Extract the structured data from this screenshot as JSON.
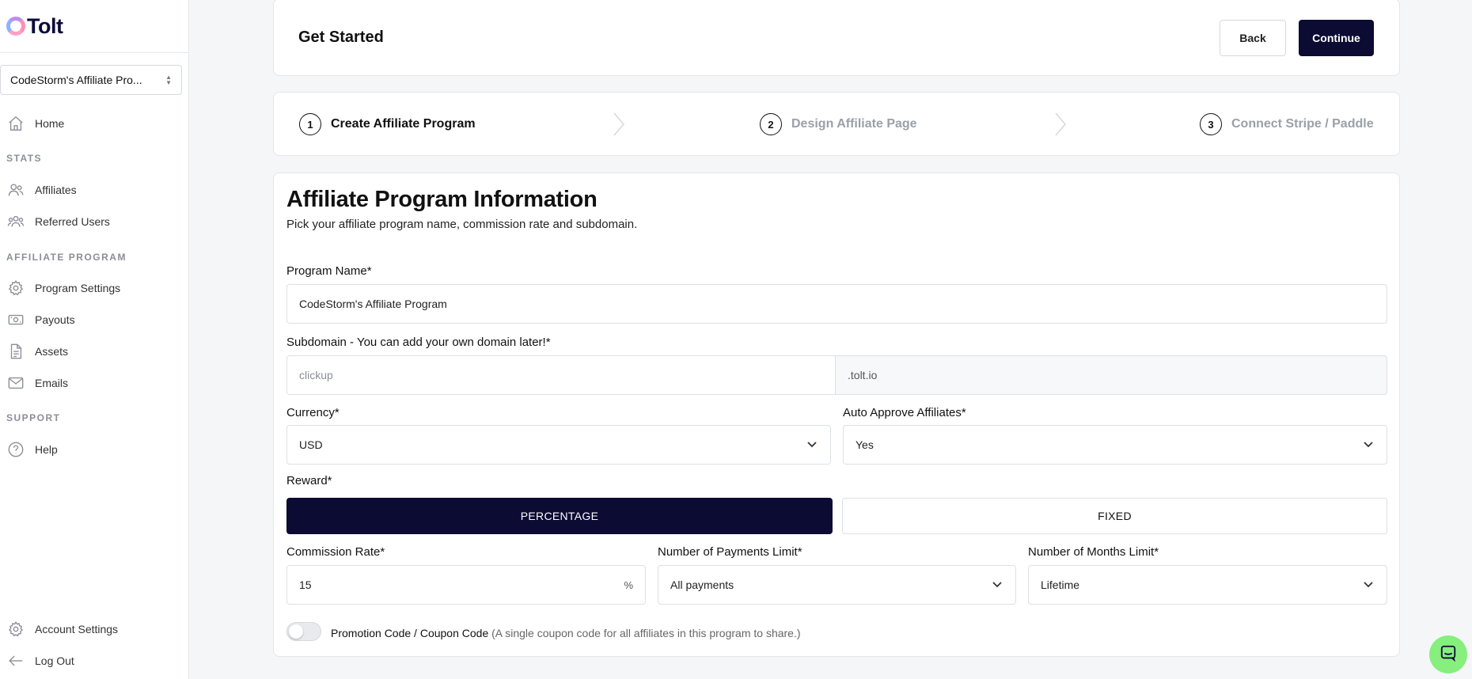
{
  "brand": {
    "name": "Tolt"
  },
  "sidebar": {
    "program_select": "CodeStorm's Affiliate Pro...",
    "home": "Home",
    "stats_label": "STATS",
    "affiliates": "Affiliates",
    "referred_users": "Referred Users",
    "program_label": "AFFILIATE PROGRAM",
    "program_settings": "Program Settings",
    "payouts": "Payouts",
    "assets": "Assets",
    "emails": "Emails",
    "support_label": "SUPPORT",
    "help": "Help",
    "account_settings": "Account Settings",
    "log_out": "Log Out"
  },
  "header": {
    "title": "Get Started",
    "back_label": "Back",
    "continue_label": "Continue"
  },
  "steps": [
    {
      "num": "1",
      "label": "Create Affiliate Program",
      "state": "active"
    },
    {
      "num": "2",
      "label": "Design Affiliate Page",
      "state": "inactive"
    },
    {
      "num": "3",
      "label": "Connect Stripe / Paddle",
      "state": "inactive"
    }
  ],
  "form": {
    "title": "Affiliate Program Information",
    "subtitle": "Pick your affiliate program name, commission rate and subdomain.",
    "program_name_label": "Program Name*",
    "program_name_value": "CodeStorm's Affiliate Program",
    "subdomain_label": "Subdomain - You can add your own domain later!*",
    "subdomain_placeholder": "clickup",
    "subdomain_suffix": ".tolt.io",
    "currency_label": "Currency*",
    "currency_value": "USD",
    "auto_approve_label": "Auto Approve Affiliates*",
    "auto_approve_value": "Yes",
    "reward_label": "Reward*",
    "reward_percentage": "PERCENTAGE",
    "reward_fixed": "FIXED",
    "reward_selected": "PERCENTAGE",
    "commission_label": "Commission Rate*",
    "commission_value": "15",
    "commission_unit": "%",
    "payments_limit_label": "Number of Payments Limit*",
    "payments_limit_value": "All payments",
    "months_limit_label": "Number of Months Limit*",
    "months_limit_value": "Lifetime",
    "promo_label": "Promotion Code / Coupon Code",
    "promo_hint": "(A single coupon code for all affiliates in this program to share.)",
    "promo_enabled": false
  },
  "colors": {
    "primary": "#0b0b33",
    "chat": "#86ef7d"
  }
}
